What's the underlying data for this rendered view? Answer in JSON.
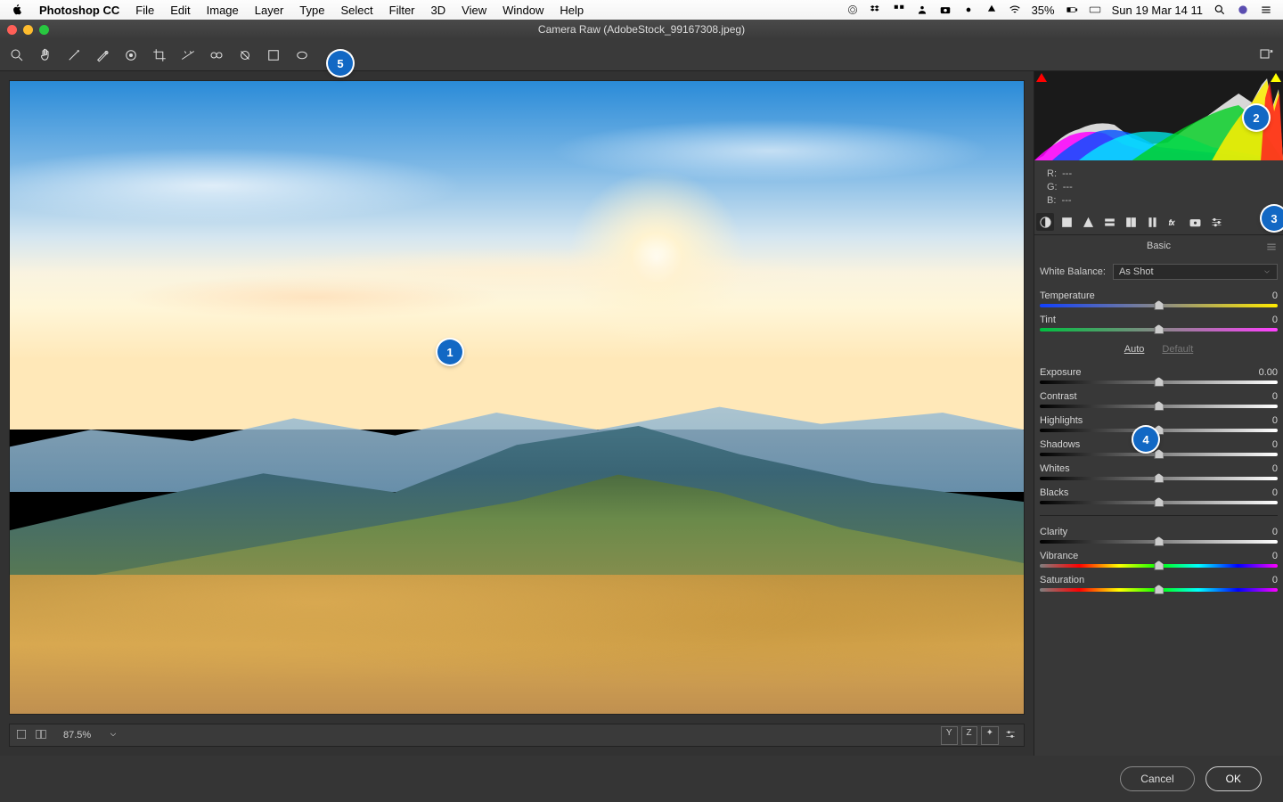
{
  "menubar": {
    "app": "Photoshop CC",
    "items": [
      "File",
      "Edit",
      "Image",
      "Layer",
      "Type",
      "Select",
      "Filter",
      "3D",
      "View",
      "Window",
      "Help"
    ],
    "battery": "35%",
    "clock": "Sun 19 Mar  14 11"
  },
  "window": {
    "title": "Camera Raw (AdobeStock_99167308.jpeg)"
  },
  "rgb": {
    "r_label": "R:",
    "g_label": "G:",
    "b_label": "B:",
    "r": "---",
    "g": "---",
    "b": "---"
  },
  "panel_title": "Basic",
  "wb": {
    "label": "White Balance:",
    "value": "As Shot"
  },
  "sliders": {
    "temperature": {
      "label": "Temperature",
      "value": "0"
    },
    "tint": {
      "label": "Tint",
      "value": "0"
    },
    "exposure": {
      "label": "Exposure",
      "value": "0.00"
    },
    "contrast": {
      "label": "Contrast",
      "value": "0"
    },
    "highlights": {
      "label": "Highlights",
      "value": "0"
    },
    "shadows": {
      "label": "Shadows",
      "value": "0"
    },
    "whites": {
      "label": "Whites",
      "value": "0"
    },
    "blacks": {
      "label": "Blacks",
      "value": "0"
    },
    "clarity": {
      "label": "Clarity",
      "value": "0"
    },
    "vibrance": {
      "label": "Vibrance",
      "value": "0"
    },
    "saturation": {
      "label": "Saturation",
      "value": "0"
    }
  },
  "auto": {
    "auto": "Auto",
    "default": "Default"
  },
  "zoom": "87.5%",
  "footer": {
    "cancel": "Cancel",
    "ok": "OK"
  },
  "callouts": {
    "c1": "1",
    "c2": "2",
    "c3": "3",
    "c4": "4",
    "c5": "5"
  }
}
